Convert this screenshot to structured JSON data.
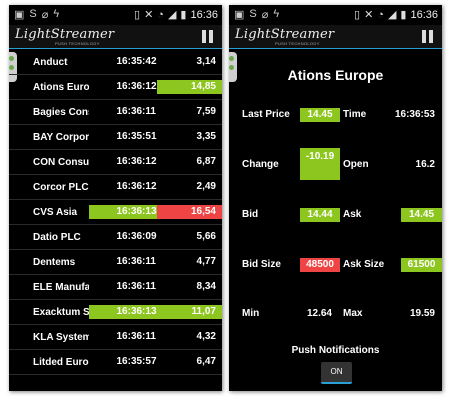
{
  "statusbar": {
    "time": "16:36"
  },
  "app": {
    "logo": "LightStreamer",
    "logo_sub": "PUSH TECHNOLOGY"
  },
  "list": [
    {
      "name": "Anduct",
      "time": "16:35:42",
      "price": "3,14",
      "hl": ""
    },
    {
      "name": "Ations Europe",
      "time": "16:36:12",
      "price": "14,85",
      "hl": "price-green"
    },
    {
      "name": "Bagies Consulting",
      "time": "16:36:11",
      "price": "7,59",
      "hl": ""
    },
    {
      "name": "BAY Corporation",
      "time": "16:35:51",
      "price": "3,35",
      "hl": ""
    },
    {
      "name": "CON Consulting",
      "time": "16:36:12",
      "price": "6,87",
      "hl": ""
    },
    {
      "name": "Corcor PLC",
      "time": "16:36:12",
      "price": "2,49",
      "hl": ""
    },
    {
      "name": "CVS Asia",
      "time": "16:36:13",
      "price": "16,54",
      "hl": "time-green-price-red"
    },
    {
      "name": "Datio PLC",
      "time": "16:36:09",
      "price": "5,66",
      "hl": ""
    },
    {
      "name": "Dentems",
      "time": "16:36:11",
      "price": "4,77",
      "hl": ""
    },
    {
      "name": "ELE Manufacturing",
      "time": "16:36:11",
      "price": "8,34",
      "hl": ""
    },
    {
      "name": "Exacktum Systems",
      "time": "16:36:13",
      "price": "11,07",
      "hl": "both-green"
    },
    {
      "name": "KLA Systems Inc",
      "time": "16:36:11",
      "price": "4,32",
      "hl": ""
    },
    {
      "name": "Litded Europe",
      "time": "16:35:57",
      "price": "6,47",
      "hl": ""
    }
  ],
  "detail": {
    "title": "Ations Europe",
    "last_price_label": "Last Price",
    "last_price": "14.45",
    "time_label": "Time",
    "time": "16:36:53",
    "change_label": "Change",
    "change": "-10.19",
    "open_label": "Open",
    "open": "16.2",
    "bid_label": "Bid",
    "bid": "14.44",
    "ask_label": "Ask",
    "ask": "14.45",
    "bid_size_label": "Bid Size",
    "bid_size": "48500",
    "ask_size_label": "Ask Size",
    "ask_size": "61500",
    "min_label": "Min",
    "min": "12.64",
    "max_label": "Max",
    "max": "19.59"
  },
  "push": {
    "title": "Push Notifications",
    "toggle": "ON"
  },
  "colors": {
    "green": "#8dc61e",
    "red": "#ef4444",
    "accent": "#2a9fd6"
  }
}
